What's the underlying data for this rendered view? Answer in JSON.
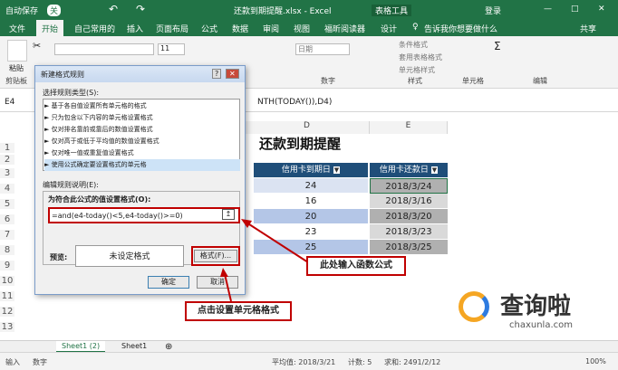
{
  "titlebar": {
    "autosave": "自动保存",
    "autosave_state": "关",
    "filename": "还款到期提醒.xlsx  -  Excel",
    "context_tab": "表格工具",
    "login": "登录"
  },
  "menu": [
    "文件",
    "开始",
    "自己常用的",
    "插入",
    "页面布局",
    "公式",
    "数据",
    "审阅",
    "视图",
    "福昕阅读器",
    "设计"
  ],
  "menu_active": "开始",
  "tellme": "告诉我你想要做什么",
  "share": "共享",
  "ribbon": {
    "paste": "粘贴",
    "clipboard": "剪贴板",
    "font_size": "11",
    "number_format": "日期",
    "number_group": "数字",
    "style_items": [
      "条件格式",
      "套用表格格式",
      "单元格样式"
    ],
    "style_group": "样式",
    "cells_group": "单元格",
    "editing_group": "编辑"
  },
  "formula": {
    "namebox": "E4",
    "content": "NTH(TODAY()),D4)"
  },
  "sheet": {
    "title": "还款到期提醒",
    "col_d": "D",
    "col_e": "E",
    "rows": [
      "1",
      "2",
      "3",
      "4",
      "5",
      "6",
      "7",
      "8",
      "9",
      "10",
      "11",
      "12",
      "13",
      "14"
    ],
    "header_d": "信用卡到期日",
    "header_e": "信用卡还款日",
    "data": [
      {
        "d": "24",
        "e": "2018/3/24"
      },
      {
        "d": "16",
        "e": "2018/3/16"
      },
      {
        "d": "20",
        "e": "2018/3/20"
      },
      {
        "d": "23",
        "e": "2018/3/23"
      },
      {
        "d": "25",
        "e": "2018/3/25"
      }
    ]
  },
  "dialog": {
    "title": "新建格式规则",
    "rule_type_label": "选择规则类型(S):",
    "rule_types": [
      "► 基于各自值设置所有单元格的格式",
      "► 只为包含以下内容的单元格设置格式",
      "► 仅对排名靠前或靠后的数值设置格式",
      "► 仅对高于或低于平均值的数值设置格式",
      "► 仅对唯一值或重复值设置格式",
      "► 使用公式确定要设置格式的单元格"
    ],
    "edit_label": "编辑规则说明(E):",
    "formula_label": "为符合此公式的值设置格式(O):",
    "formula": "=and(e4-today()<5,e4-today()>=0)",
    "preview_label": "预览:",
    "preview_text": "未设定格式",
    "format_button": "格式(F)...",
    "ok": "确定",
    "cancel": "取消"
  },
  "callouts": {
    "input_formula": "此处输入函数公式",
    "click_format": "点击设置单元格格式"
  },
  "watermark": {
    "brand": "查询啦",
    "url": "chaxunla.com"
  },
  "sheets": [
    "Sheet1 (2)",
    "Sheet1"
  ],
  "status": {
    "mode": "输入",
    "numeric": "数字",
    "average": "平均值: 2018/3/21",
    "count": "计数: 5",
    "sum": "求和: 2491/2/12",
    "zoom": "100%"
  },
  "colors": {
    "excel_green": "#217346",
    "header_blue": "#1f4e79",
    "callout_red": "#c00000",
    "band_blue": "#b4c6e7"
  }
}
